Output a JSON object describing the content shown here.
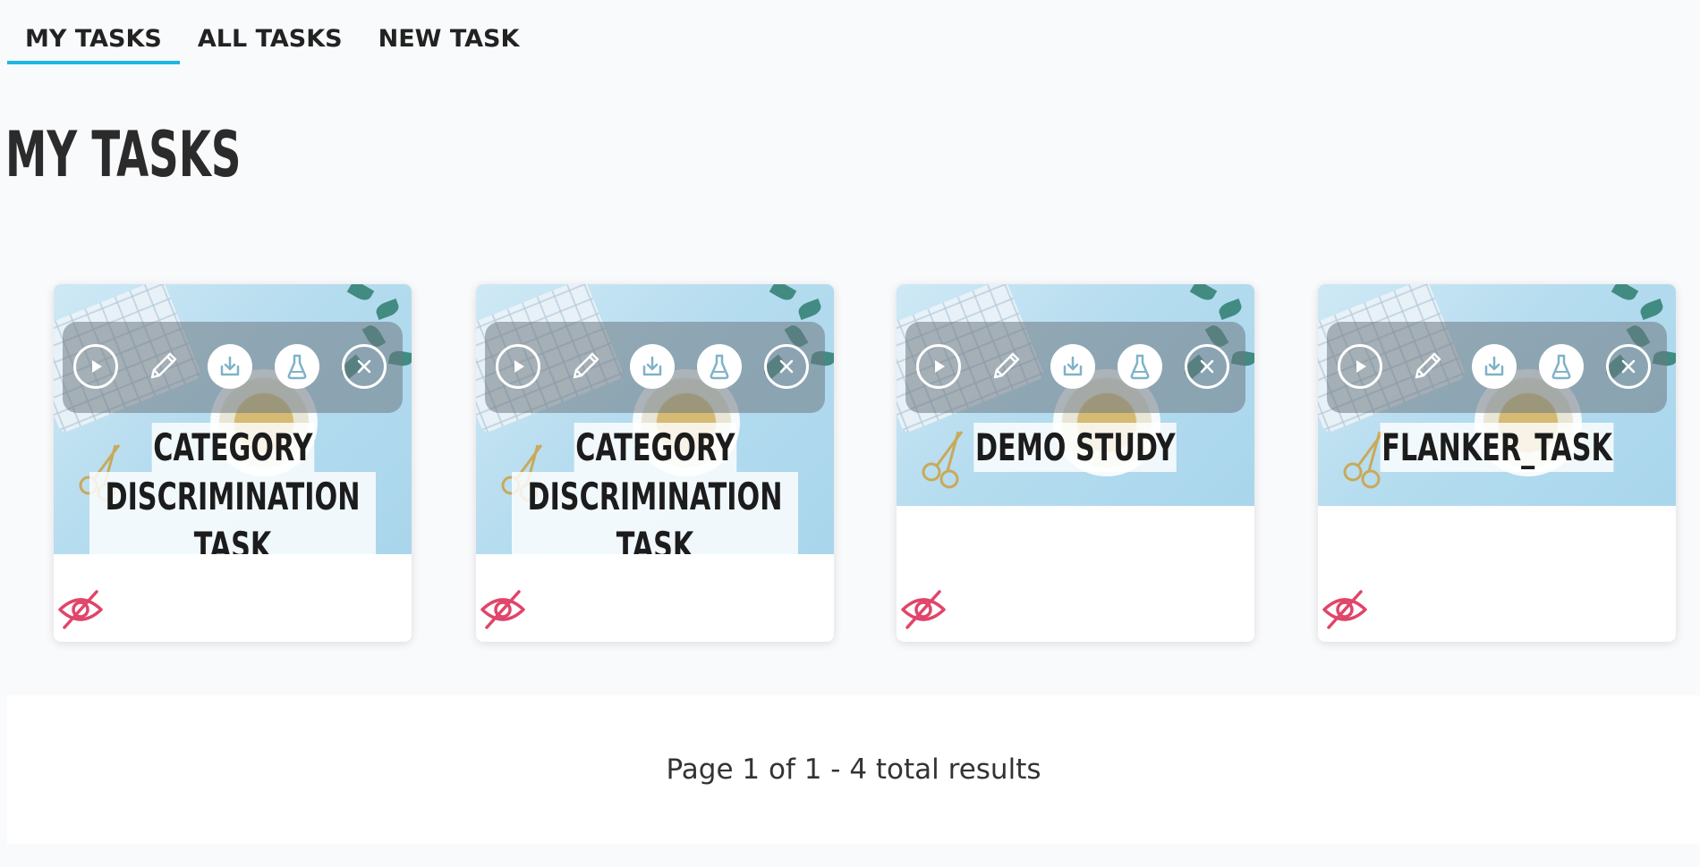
{
  "nav": {
    "tabs": [
      {
        "label": "MY TASKS",
        "active": true
      },
      {
        "label": "ALL TASKS",
        "active": false
      },
      {
        "label": "NEW TASK",
        "active": false
      }
    ]
  },
  "page_title": "MY TASKS",
  "cards": [
    {
      "title_lines": [
        "CATEGORY",
        "DISCRIMINATION TASK"
      ],
      "actions": [
        "play-icon",
        "pencil-icon",
        "download-icon",
        "flask-icon",
        "close-icon"
      ],
      "visibility": "hidden-eye-icon"
    },
    {
      "title_lines": [
        "CATEGORY",
        "DISCRIMINATION TASK"
      ],
      "actions": [
        "play-icon",
        "pencil-icon",
        "download-icon",
        "flask-icon",
        "close-icon"
      ],
      "visibility": "hidden-eye-icon"
    },
    {
      "title_lines": [
        "DEMO STUDY"
      ],
      "actions": [
        "play-icon",
        "pencil-icon",
        "download-icon",
        "flask-icon",
        "close-icon"
      ],
      "visibility": "hidden-eye-icon"
    },
    {
      "title_lines": [
        "FLANKER_TASK"
      ],
      "actions": [
        "play-icon",
        "pencil-icon",
        "download-icon",
        "flask-icon",
        "close-icon"
      ],
      "visibility": "hidden-eye-icon"
    }
  ],
  "pagination": {
    "text": "Page 1 of 1 - 4 total results"
  },
  "colors": {
    "accent": "#1eb6e2",
    "hidden_icon": "#e0456a",
    "background": "#f9fafc"
  }
}
